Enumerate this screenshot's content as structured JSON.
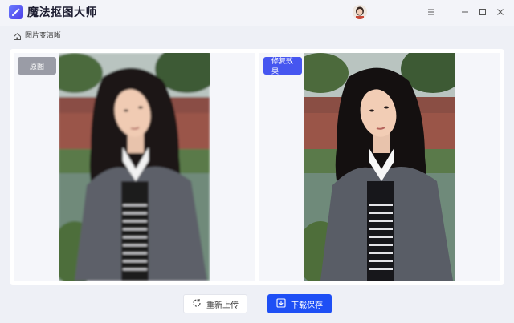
{
  "app": {
    "title": "魔法抠图大师",
    "logo_icon": "wand-logo-icon"
  },
  "window_controls": {
    "menu_icon": "menu-icon",
    "minimize_icon": "minimize-icon",
    "maximize_icon": "maximize-icon",
    "close_icon": "close-icon"
  },
  "breadcrumb": {
    "icon": "home-icon",
    "label": "图片变清晰"
  },
  "panes": {
    "original_label": "原图",
    "result_label": "修复效果"
  },
  "actions": {
    "reupload_label": "重新上传",
    "reupload_icon": "refresh-icon",
    "save_label": "下载保存",
    "save_icon": "download-icon"
  },
  "colors": {
    "accent": "#1e4ff5",
    "badge_result": "#4656f0",
    "badge_original": "#9a9ca6"
  }
}
